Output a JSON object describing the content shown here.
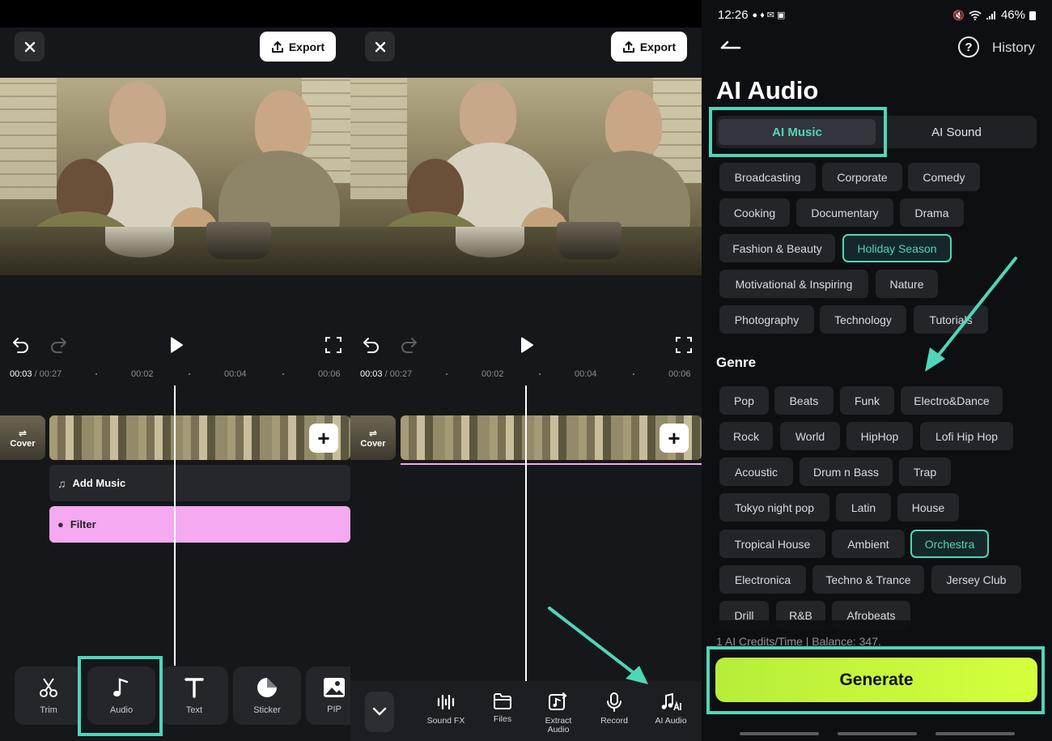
{
  "editor": {
    "export_label": "Export",
    "current_time": "00:03",
    "total_time": "/ 00:27",
    "marks": [
      "00:02",
      "00:04",
      "00:06"
    ],
    "cover_label": "Cover",
    "add_music_label": "Add Music",
    "filter_label": "Filter"
  },
  "toolbar1": [
    "Trim",
    "Audio",
    "Text",
    "Sticker",
    "PIP"
  ],
  "toolbar2": [
    "Sound FX",
    "Files",
    "Extract Audio",
    "Record",
    "AI Audio"
  ],
  "status": {
    "time": "12:26",
    "battery": "46%"
  },
  "ai_audio": {
    "history_label": "History",
    "title": "AI Audio",
    "tabs": [
      "AI Music",
      "AI Sound"
    ],
    "themes": [
      "Broadcasting",
      "Corporate",
      "Comedy",
      "Cooking",
      "Documentary",
      "Drama",
      "Fashion & Beauty",
      "Holiday Season",
      "Motivational & Inspiring",
      "Nature",
      "Photography",
      "Technology",
      "Tutorials"
    ],
    "selected_theme": "Holiday Season",
    "genre_heading": "Genre",
    "genres": [
      "Pop",
      "Beats",
      "Funk",
      "Electro&Dance",
      "Rock",
      "World",
      "HipHop",
      "Lofi Hip Hop",
      "Acoustic",
      "Drum n Bass",
      "Trap",
      "Tokyo night pop",
      "Latin",
      "House",
      "Tropical House",
      "Ambient",
      "Orchestra",
      "Electronica",
      "Techno & Trance",
      "Jersey Club",
      "Drill",
      "R&B",
      "Afrobeats"
    ],
    "selected_genre": "Orchestra",
    "credits_text": "1 AI Credits/Time | Balance: 347.",
    "generate_label": "Generate"
  },
  "colors": {
    "accent": "#4fd6b8",
    "generate": "#c8f83a",
    "filter_track": "#f5a9f0"
  }
}
